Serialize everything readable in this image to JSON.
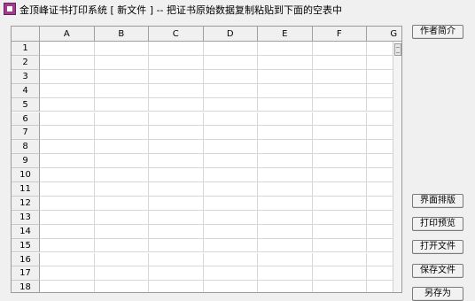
{
  "window": {
    "title": "金顶峰证书打印系统 [ 新文件 ] -- 把证书原始数据复制粘贴到下面的空表中"
  },
  "sheet": {
    "columns": [
      "A",
      "B",
      "C",
      "D",
      "E",
      "F",
      "G"
    ],
    "rows": [
      "1",
      "2",
      "3",
      "4",
      "5",
      "6",
      "7",
      "8",
      "9",
      "10",
      "11",
      "12",
      "13",
      "14",
      "15",
      "16",
      "17",
      "18"
    ]
  },
  "buttons": {
    "author_intro": "作者简介",
    "layout": "界面排版",
    "print_preview": "打印预览",
    "open_file": "打开文件",
    "save_file": "保存文件",
    "save_as": "另存为"
  }
}
